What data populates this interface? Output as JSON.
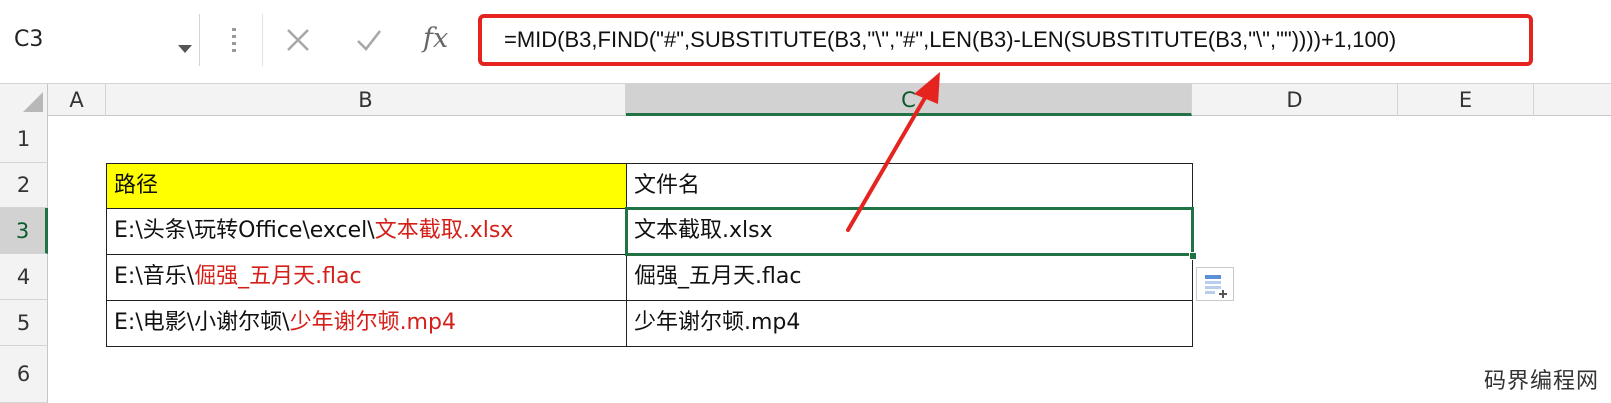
{
  "formula_bar": {
    "name_box": "C3",
    "fx_label": "fx",
    "formula": "=MID(B3,FIND(\"#\",SUBSTITUTE(B3,\"\\\",\"#\",LEN(B3)-LEN(SUBSTITUTE(B3,\"\\\",\"\"))))+1,100)"
  },
  "columns": [
    "A",
    "B",
    "C",
    "D",
    "E"
  ],
  "selected_column": "C",
  "rows": [
    "1",
    "2",
    "3",
    "4",
    "5",
    "6"
  ],
  "selected_row": "3",
  "table": {
    "header": {
      "path": "路径",
      "filename": "文件名"
    },
    "rows": [
      {
        "path_prefix": "E:\\头条\\玩转Office\\excel\\",
        "path_file": "文本截取.xlsx",
        "filename": "文本截取.xlsx"
      },
      {
        "path_prefix": "E:\\音乐\\",
        "path_file": "倔强_五月天.flac",
        "filename": "倔强_五月天.flac"
      },
      {
        "path_prefix": "E:\\电影\\小谢尔顿\\",
        "path_file": "少年谢尔顿.mp4",
        "filename": "少年谢尔顿.mp4"
      }
    ]
  },
  "watermark": "码界编程网",
  "colors": {
    "highlight_box": "#e52420",
    "header_fill": "#ffff00",
    "red_text": "#d5201a",
    "selection_green": "#217346"
  }
}
